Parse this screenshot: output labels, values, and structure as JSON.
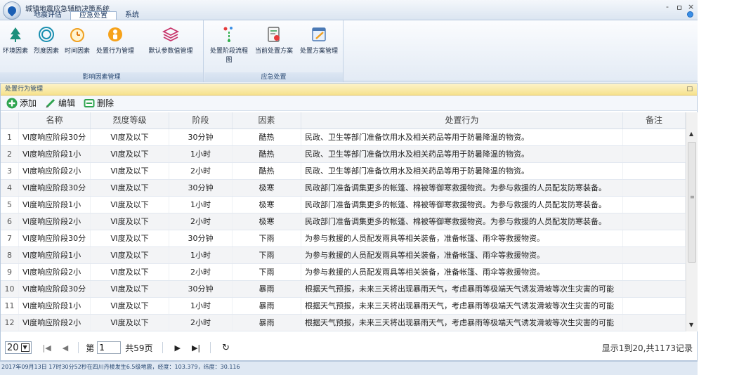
{
  "app": {
    "title": "城镇地震应急辅助决策系统",
    "window_controls": [
      "-",
      "ㅁ",
      "×"
    ]
  },
  "tabs": [
    "地震评估",
    "应急处置",
    "系统"
  ],
  "ribbon": {
    "groups": [
      {
        "label": "影响因素管理",
        "buttons": [
          "环境因素",
          "烈度因素",
          "时间因素",
          "处置行为管理",
          "默认参数值管理"
        ]
      },
      {
        "label": "应急处置",
        "buttons": [
          "处置阶段流程图",
          "当前处置方案",
          "处置方案管理"
        ]
      }
    ]
  },
  "panel": {
    "title": "处置行为管理",
    "restore_icon": "restore-icon"
  },
  "toolbar": {
    "add": "添加",
    "edit": "编辑",
    "delete": "删除"
  },
  "table": {
    "columns": [
      "",
      "名称",
      "烈度等级",
      "阶段",
      "因素",
      "处置行为",
      "备注"
    ],
    "rows": [
      [
        "1",
        "Ⅵ度响应阶段30分",
        "Ⅵ度及以下",
        "30分钟",
        "酷热",
        "民政、卫生等部门准备饮用水及相关药品等用于防暑降温的物资。",
        ""
      ],
      [
        "2",
        "Ⅵ度响应阶段1小",
        "Ⅵ度及以下",
        "1小时",
        "酷热",
        "民政、卫生等部门准备饮用水及相关药品等用于防暑降温的物资。",
        ""
      ],
      [
        "3",
        "Ⅵ度响应阶段2小",
        "Ⅵ度及以下",
        "2小时",
        "酷热",
        "民政、卫生等部门准备饮用水及相关药品等用于防暑降温的物资。",
        ""
      ],
      [
        "4",
        "Ⅵ度响应阶段30分",
        "Ⅵ度及以下",
        "30分钟",
        "极寒",
        "民政部门准备调集更多的帐篷、棉被等御寒救援物资。为参与救援的人员配发防寒装备。",
        ""
      ],
      [
        "5",
        "Ⅵ度响应阶段1小",
        "Ⅵ度及以下",
        "1小时",
        "极寒",
        "民政部门准备调集更多的帐篷、棉被等御寒救援物资。为参与救援的人员配发防寒装备。",
        ""
      ],
      [
        "6",
        "Ⅵ度响应阶段2小",
        "Ⅵ度及以下",
        "2小时",
        "极寒",
        "民政部门准备调集更多的帐篷、棉被等御寒救援物资。为参与救援的人员配发防寒装备。",
        ""
      ],
      [
        "7",
        "Ⅵ度响应阶段30分",
        "Ⅵ度及以下",
        "30分钟",
        "下雨",
        "为参与救援的人员配发雨具等相关装备，准备帐篷、雨伞等救援物资。",
        ""
      ],
      [
        "8",
        "Ⅵ度响应阶段1小",
        "Ⅵ度及以下",
        "1小时",
        "下雨",
        "为参与救援的人员配发雨具等相关装备，准备帐篷、雨伞等救援物资。",
        ""
      ],
      [
        "9",
        "Ⅵ度响应阶段2小",
        "Ⅵ度及以下",
        "2小时",
        "下雨",
        "为参与救援的人员配发雨具等相关装备，准备帐篷、雨伞等救援物资。",
        ""
      ],
      [
        "10",
        "Ⅵ度响应阶段30分",
        "Ⅵ度及以下",
        "30分钟",
        "暴雨",
        "根据天气预报，未来三天将出现暴雨天气，考虑暴雨等极端天气诱发滑坡等次生灾害的可能",
        ""
      ],
      [
        "11",
        "Ⅵ度响应阶段1小",
        "Ⅵ度及以下",
        "1小时",
        "暴雨",
        "根据天气预报，未来三天将出现暴雨天气，考虑暴雨等极端天气诱发滑坡等次生灾害的可能",
        ""
      ],
      [
        "12",
        "Ⅵ度响应阶段2小",
        "Ⅵ度及以下",
        "2小时",
        "暴雨",
        "根据天气预报，未来三天将出现暴雨天气，考虑暴雨等极端天气诱发滑坡等次生灾害的可能",
        ""
      ]
    ]
  },
  "pager": {
    "page_size": "20",
    "page_prefix": "第",
    "current_page": "1",
    "page_total": "共59页",
    "summary": "显示1到20,共1173记录"
  },
  "status": "2017年09月13日 17时30分52秒在四川丹棱发生6.5级地震，经度：103.379，纬度：30.116"
}
